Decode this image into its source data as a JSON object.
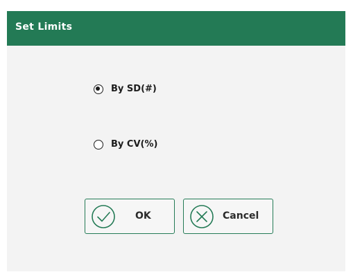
{
  "dialog": {
    "title": "Set Limits",
    "options": [
      {
        "label": "By SD(#)",
        "selected": true
      },
      {
        "label": "By CV(%)",
        "selected": false
      }
    ],
    "buttons": {
      "ok_label": "OK",
      "cancel_label": "Cancel"
    }
  },
  "colors": {
    "accent": "#237a55",
    "dialog_background": "#f3f3f3",
    "text": "#1c1c1c"
  },
  "icons": {
    "ok": "check-circle-icon",
    "cancel": "x-circle-icon"
  }
}
